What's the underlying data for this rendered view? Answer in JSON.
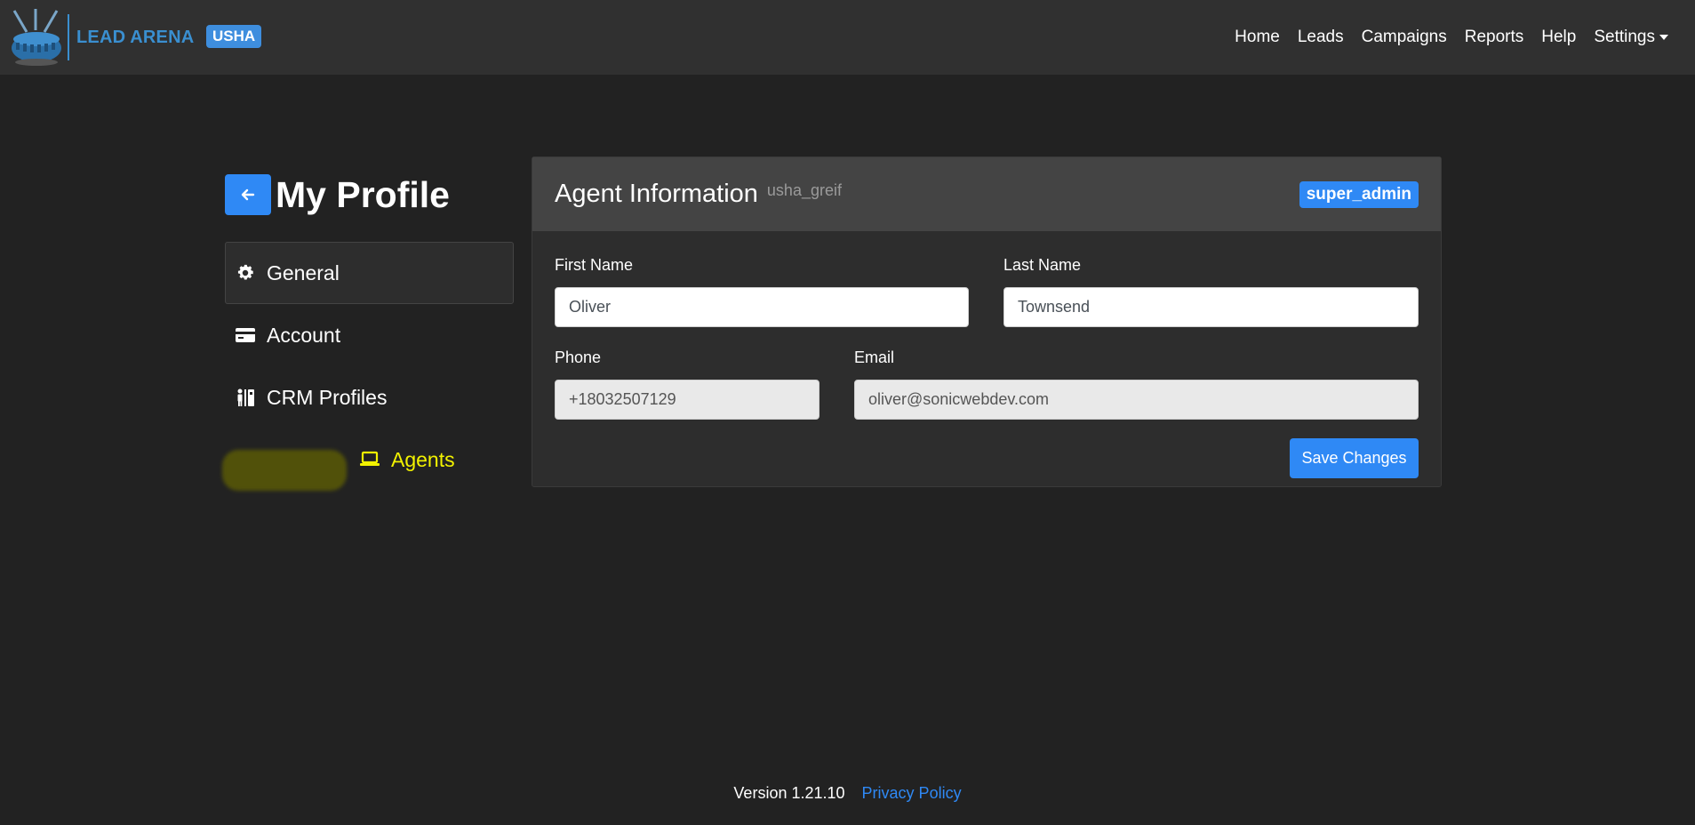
{
  "navbar": {
    "brand_text": "LEAD ARENA",
    "tenant_badge": "USHA",
    "links": {
      "home": "Home",
      "leads": "Leads",
      "campaigns": "Campaigns",
      "reports": "Reports",
      "help": "Help",
      "settings": "Settings"
    }
  },
  "sidebar": {
    "title": "My Profile",
    "items": [
      {
        "label": "General",
        "icon": "gear-icon",
        "active": true
      },
      {
        "label": "Account",
        "icon": "credit-card-icon"
      },
      {
        "label": "CRM Profiles",
        "icon": "people-icon"
      },
      {
        "label": "Agents",
        "icon": "laptop-icon",
        "highlighted": true
      }
    ]
  },
  "card": {
    "title": "Agent Information",
    "username": "usha_greif",
    "role": "super_admin",
    "fields": {
      "first_name_label": "First Name",
      "first_name": "Oliver",
      "last_name_label": "Last Name",
      "last_name": "Townsend",
      "phone_label": "Phone",
      "phone": "+18032507129",
      "email_label": "Email",
      "email": "oliver@sonicwebdev.com"
    },
    "save_label": "Save Changes"
  },
  "footer": {
    "version": "Version 1.21.10",
    "privacy": "Privacy Policy"
  },
  "colors": {
    "background": "#222222",
    "navbar": "#303030",
    "accent": "#2f89f5",
    "highlight": "#f2f200"
  }
}
